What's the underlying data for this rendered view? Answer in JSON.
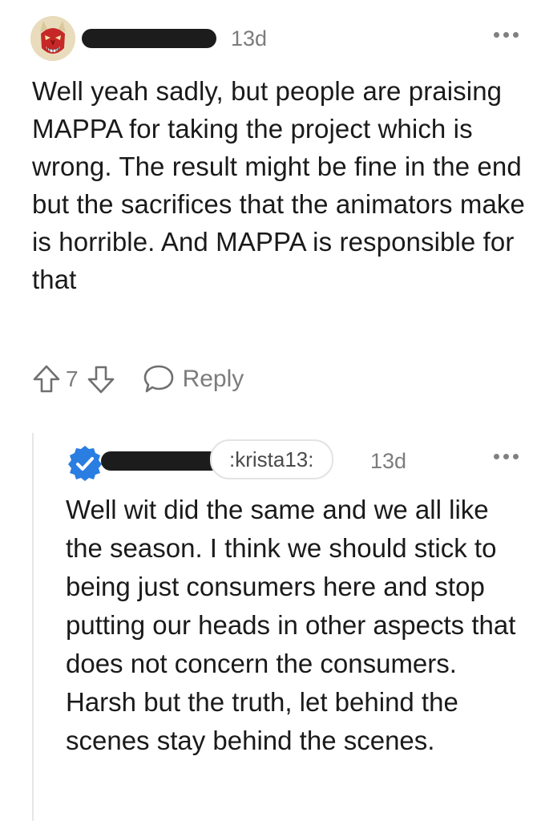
{
  "comment": {
    "time": "13d",
    "body": "Well yeah sadly, but people are praising MAPPA for taking the project which is wrong. The result might be fine in the end but the sacrifices that the animators make is horrible. And MAPPA is responsible for that",
    "vote_count": "7",
    "reply_label": "Reply",
    "avatar_icon": "oni-mask-avatar",
    "more_icon": "more-options-icon"
  },
  "reply": {
    "flair": ":krista13:",
    "time": "13d",
    "body": "Well wit did the same and we all like the season. I think we should stick to being just consumers here and stop putting our heads in other aspects that does not concern the consumers. Harsh but the truth, let behind the scenes stay behind the scenes.",
    "badge_icon": "verified-badge-icon",
    "badge_color": "#2a7de1",
    "more_icon": "more-options-icon"
  }
}
